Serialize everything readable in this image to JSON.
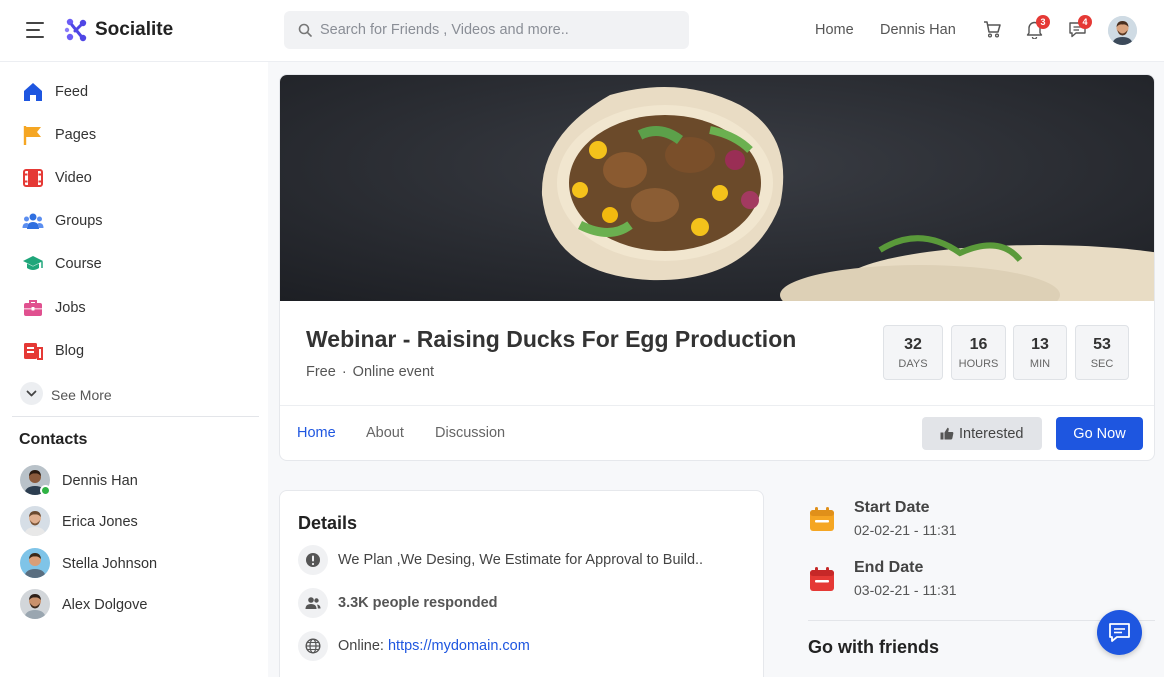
{
  "app": {
    "brand": "Socialite"
  },
  "header": {
    "search_placeholder": "Search for Friends , Videos and more..",
    "nav_home": "Home",
    "nav_user": "Dennis Han",
    "notifications_count": "3",
    "messages_count": "4"
  },
  "sidebar": {
    "items": [
      {
        "label": "Feed",
        "icon": "home-icon",
        "color": "#1e56e0"
      },
      {
        "label": "Pages",
        "icon": "flag-icon",
        "color": "#f5a623"
      },
      {
        "label": "Video",
        "icon": "film-icon",
        "color": "#e53935"
      },
      {
        "label": "Groups",
        "icon": "users-icon",
        "color": "#2f6fe0"
      },
      {
        "label": "Course",
        "icon": "graduation-cap-icon",
        "color": "#1fa67a"
      },
      {
        "label": "Jobs",
        "icon": "briefcase-icon",
        "color": "#e0508f"
      },
      {
        "label": "Blog",
        "icon": "blog-icon",
        "color": "#e53935"
      }
    ],
    "see_more": "See More",
    "contacts_title": "Contacts",
    "contacts": [
      {
        "name": "Dennis Han",
        "online": true
      },
      {
        "name": "Erica Jones"
      },
      {
        "name": "Stella Johnson"
      },
      {
        "name": "Alex Dolgove"
      }
    ]
  },
  "event": {
    "title": "Webinar - Raising Ducks For Egg Production",
    "price": "Free",
    "type": "Online event",
    "countdown": [
      {
        "value": "32",
        "unit": "DAYS"
      },
      {
        "value": "16",
        "unit": "HOURS"
      },
      {
        "value": "13",
        "unit": "MIN"
      },
      {
        "value": "53",
        "unit": "SEC"
      }
    ],
    "tabs": [
      {
        "label": "Home",
        "active": true
      },
      {
        "label": "About"
      },
      {
        "label": "Discussion"
      }
    ],
    "interested_label": "Interested",
    "go_now_label": "Go Now"
  },
  "details": {
    "title": "Details",
    "description": "We Plan ,We Desing, We Estimate for Approval to Build..",
    "responded": "3.3K people responded",
    "online_prefix": "Online: ",
    "online_link": "https://mydomain.com"
  },
  "dates": {
    "start_label": "Start Date",
    "start_value": "02-02-21 - 11:31",
    "end_label": "End Date",
    "end_value": "03-02-21 - 11:31"
  },
  "friends": {
    "title": "Go with friends"
  },
  "colors": {
    "accent": "#1e56e0",
    "badge": "#e53935",
    "start_date": "#f5a623",
    "end_date": "#e53935"
  }
}
